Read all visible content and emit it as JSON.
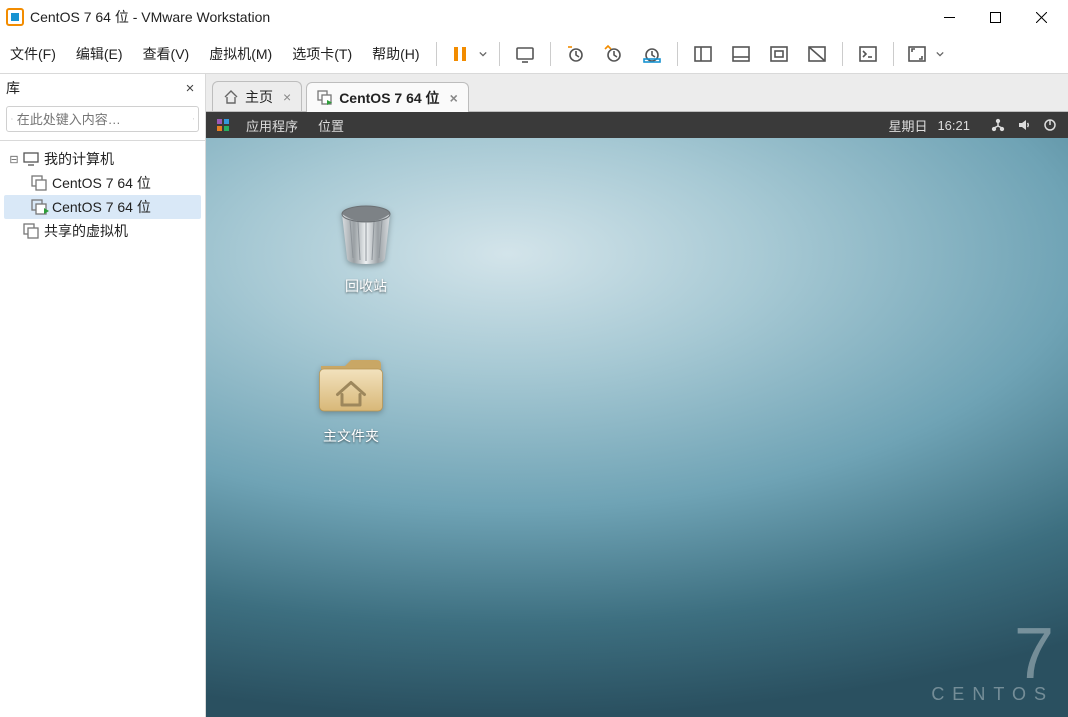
{
  "window": {
    "title": "CentOS 7 64 位 - VMware Workstation"
  },
  "menu": {
    "file": "文件(F)",
    "edit": "编辑(E)",
    "view": "查看(V)",
    "vm": "虚拟机(M)",
    "tabs": "选项卡(T)",
    "help": "帮助(H)"
  },
  "library": {
    "title": "库",
    "search_placeholder": "在此处键入内容…",
    "tree": {
      "my_computer": "我的计算机",
      "vm1": "CentOS 7 64 位",
      "vm2": "CentOS 7 64 位",
      "shared": "共享的虚拟机"
    }
  },
  "tabs": {
    "home": "主页",
    "current": "CentOS 7 64 位"
  },
  "gnome": {
    "applications": "应用程序",
    "places": "位置",
    "day": "星期日",
    "time": "16:21"
  },
  "desktop": {
    "trash": "回收站",
    "home_folder": "主文件夹"
  },
  "brand": {
    "seven": "7",
    "name": "CENTOS"
  }
}
